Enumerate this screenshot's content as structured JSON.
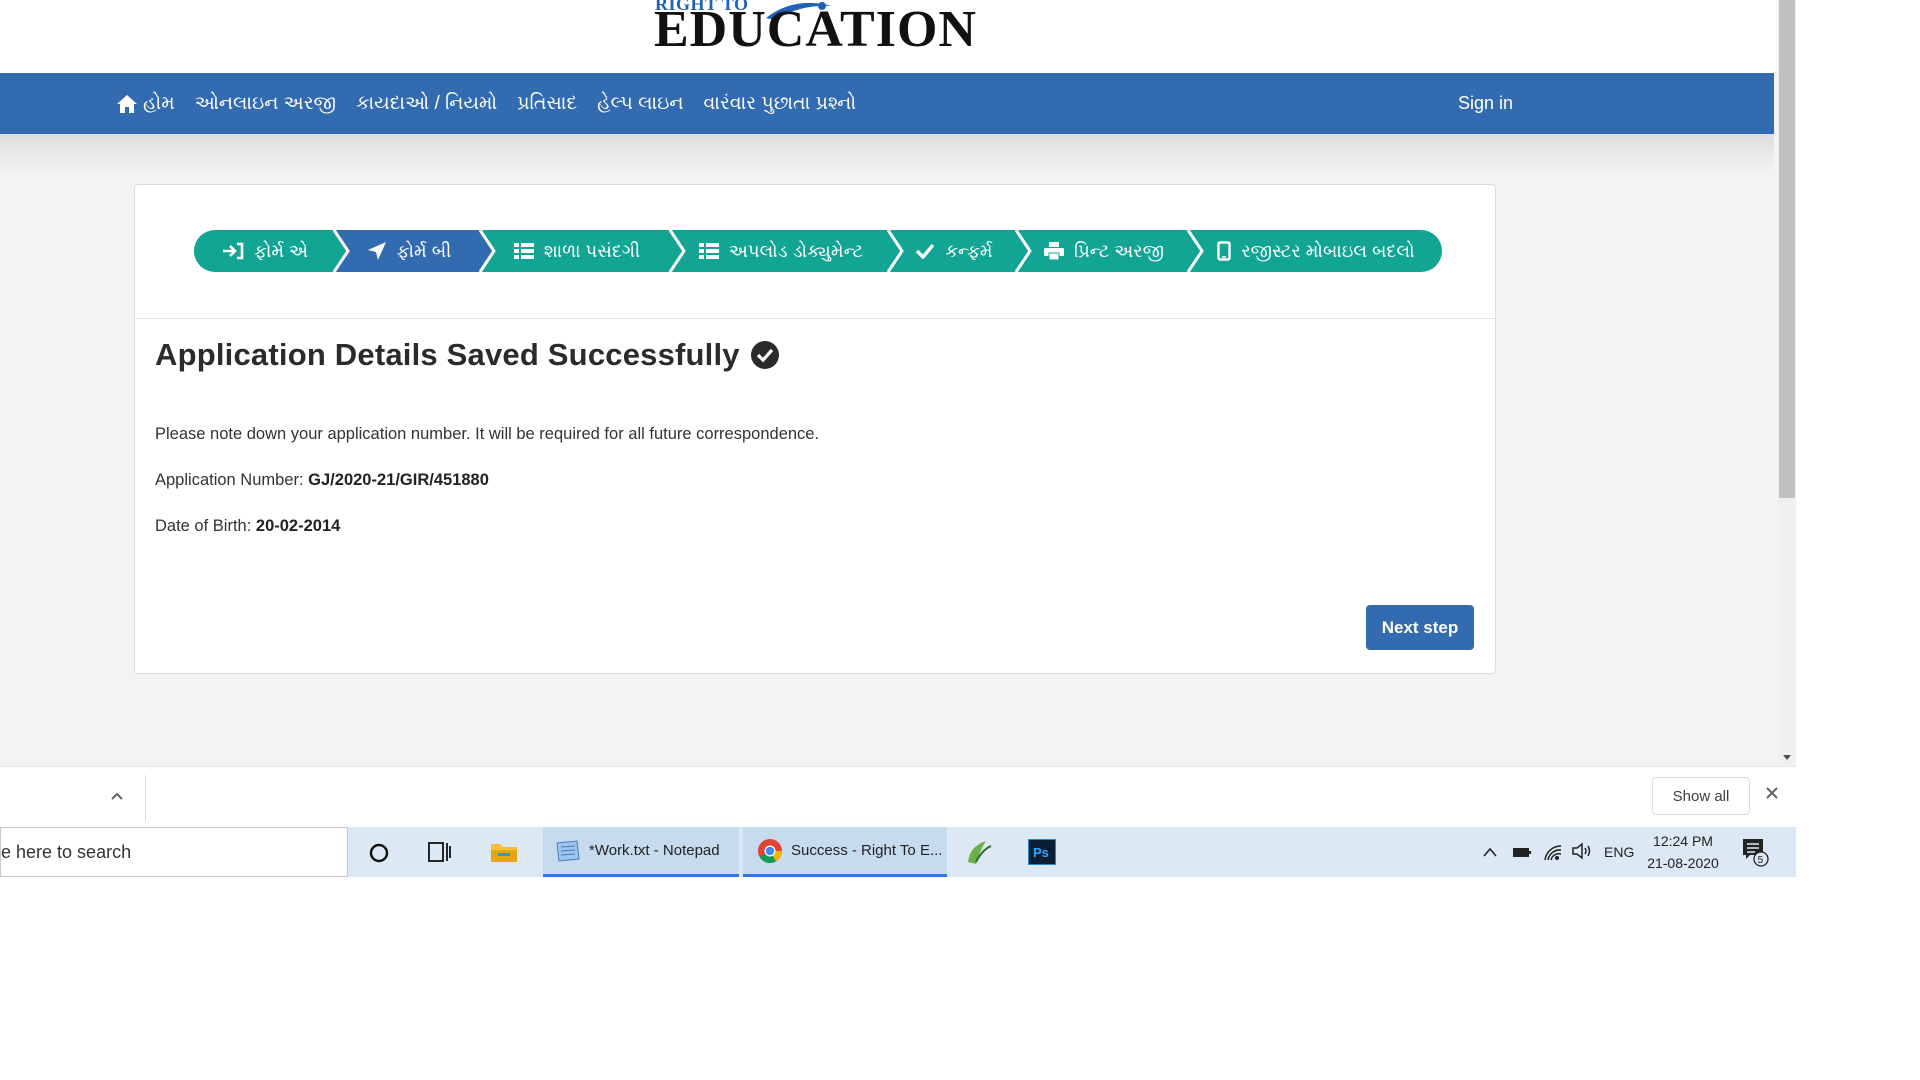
{
  "logo": {
    "small_text": "RIGHT TO",
    "big_text": "EDUCATION"
  },
  "nav": {
    "items": [
      {
        "label": "હોમ",
        "icon": "home-icon"
      },
      {
        "label": "ઓનલાઇન અરજી"
      },
      {
        "label": "કાયદાઓ / નિયમો"
      },
      {
        "label": "પ્રતિસાદ"
      },
      {
        "label": "હેલ્પ લાઇન"
      },
      {
        "label": "વારંવાર પુછાતા પ્રશ્નો"
      }
    ],
    "signin": "Sign in"
  },
  "steps": [
    {
      "label": "ફોર્મ એ",
      "icon": "sign-in-icon",
      "color": "#12a594"
    },
    {
      "label": "ફોર્મ બી",
      "icon": "send-icon",
      "color": "#336bb0"
    },
    {
      "label": "શાળા પસંદગી",
      "icon": "list-icon",
      "color": "#12a594"
    },
    {
      "label": "અપલોડ ડોક્યુમેન્ટ",
      "icon": "list-icon",
      "color": "#12a594"
    },
    {
      "label": "કન્ફર્મ",
      "icon": "check-icon",
      "color": "#12a594"
    },
    {
      "label": "પ્રિન્ટ અરજી",
      "icon": "print-icon",
      "color": "#12a594"
    },
    {
      "label": "રજીસ્ટર મોબાઇલ બદલો",
      "icon": "mobile-icon",
      "color": "#12a594"
    }
  ],
  "content": {
    "title": "Application Details Saved Successfully",
    "note": "Please note down your application number. It will be required for all future correspondence.",
    "app_number_label": "Application Number:",
    "app_number": "GJ/2020-21/GIR/451880",
    "dob_label": "Date of Birth:",
    "dob": "20-02-2014",
    "next_button": "Next step"
  },
  "downloads_bar": {
    "show_all": "Show all"
  },
  "taskbar": {
    "search_placeholder": "e here to search",
    "apps": [
      {
        "label": "*Work.txt - Notepad",
        "icon": "notepad-icon"
      },
      {
        "label": "Success - Right To E...",
        "icon": "chrome-icon"
      }
    ],
    "tray": {
      "language": "ENG",
      "time": "12:24 PM",
      "date": "21-08-2020",
      "notification_count": "5"
    }
  },
  "colors": {
    "navbar": "#336bb0",
    "step_active": "#336bb0",
    "step_default": "#12a594",
    "button": "#336bb0"
  }
}
